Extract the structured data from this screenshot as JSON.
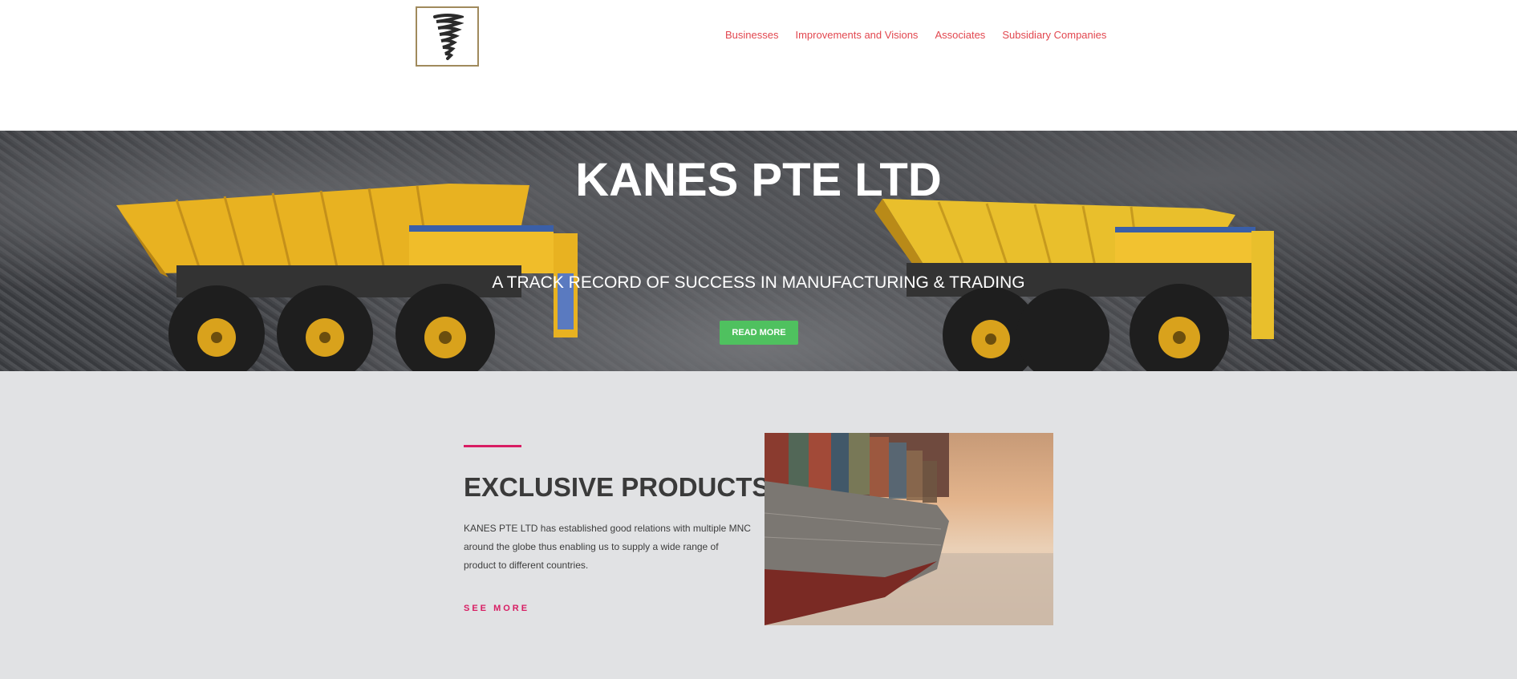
{
  "nav": {
    "items": [
      "Businesses",
      "Improvements and Visions",
      "Associates",
      "Subsidiary Companies"
    ]
  },
  "hero": {
    "title": "KANES PTE LTD",
    "subtitle": "A TRACK RECORD OF SUCCESS IN MANUFACTURING & TRADING",
    "button_label": "READ MORE"
  },
  "section": {
    "title": "EXCLUSIVE PRODUCTS",
    "text": "KANES PTE LTD has established good relations with multiple MNC around the globe thus enabling us to supply a wide range of product to different countries.",
    "link_label": "SEE MORE"
  },
  "colors": {
    "nav_link": "#e2474f",
    "button": "#4fc15f",
    "accent": "#d81d63",
    "section_bg": "#e1e2e4"
  }
}
